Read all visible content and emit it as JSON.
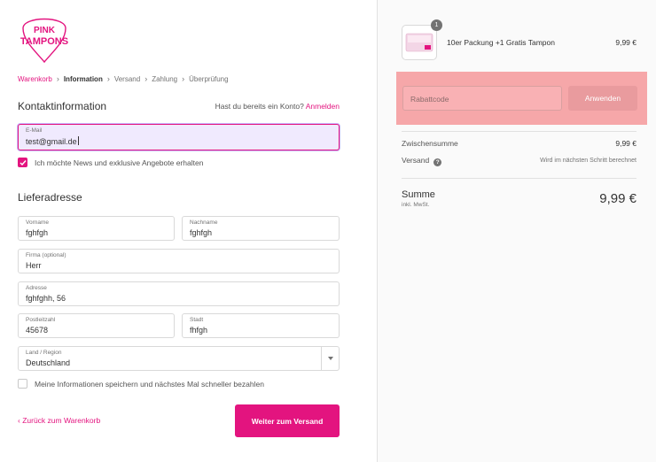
{
  "brand": {
    "logo_line1": "PINK",
    "logo_line2": "TAMPONS",
    "accent": "#e3147f"
  },
  "breadcrumb": {
    "items": [
      "Warenkorb",
      "Information",
      "Versand",
      "Zahlung",
      "Überprüfung"
    ],
    "current_index": 1
  },
  "contact": {
    "title": "Kontaktinformation",
    "account_prompt": "Hast du bereits ein Konto?",
    "login_link": "Anmelden",
    "email_label": "E-Mail",
    "email_value": "test@gmail.de",
    "newsletter_label": "Ich möchte News und exklusive Angebote erhalten",
    "newsletter_checked": true
  },
  "shipping": {
    "title": "Lieferadresse",
    "first_name": {
      "label": "Vorname",
      "value": "fghfgh"
    },
    "last_name": {
      "label": "Nachname",
      "value": "fghfgh"
    },
    "company": {
      "label": "Firma (optional)",
      "value": "Herr"
    },
    "address": {
      "label": "Adresse",
      "value": "fghfghh, 56"
    },
    "zip": {
      "label": "Postleitzahl",
      "value": "45678"
    },
    "city": {
      "label": "Stadt",
      "value": "fhfgh"
    },
    "country": {
      "label": "Land / Region",
      "value": "Deutschland"
    },
    "save_info_label": "Meine Informationen speichern und nächstes Mal schneller bezahlen",
    "save_info_checked": false
  },
  "actions": {
    "back_label": "Zurück zum Warenkorb",
    "continue_label": "Weiter zum Versand"
  },
  "order": {
    "item_name": "10er Packung +1 Gratis Tampon",
    "item_qty": "1",
    "item_price": "9,99 €",
    "discount_placeholder": "Rabattcode",
    "discount_button": "Anwenden",
    "subtotal_label": "Zwischensumme",
    "subtotal_value": "9,99 €",
    "shipping_label": "Versand",
    "shipping_value": "Wird im nächsten Schritt berechnet",
    "total_label": "Summe",
    "tax_note": "inkl. MwSt.",
    "total_value": "9,99 €"
  }
}
